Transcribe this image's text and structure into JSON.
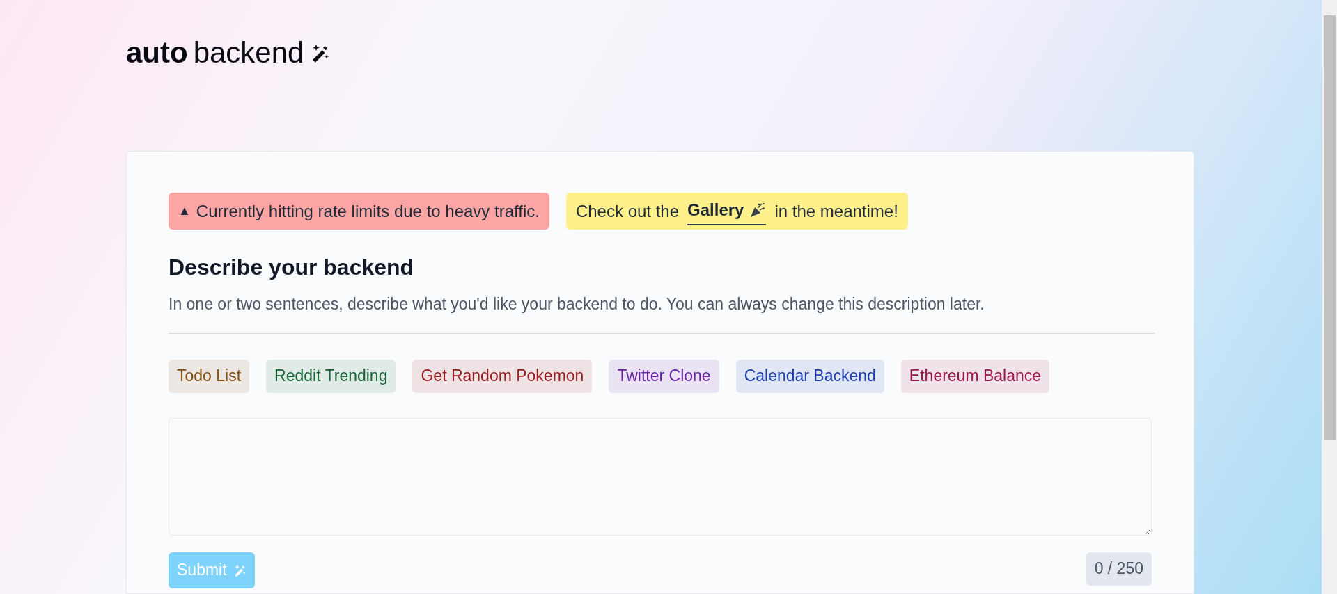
{
  "logo": {
    "bold": "auto",
    "light": "backend"
  },
  "alerts": [
    {
      "kind": "warning",
      "icon": "▲",
      "text": "Currently hitting rate limits due to heavy traffic."
    },
    {
      "kind": "info",
      "before": "Check out the",
      "link": "Gallery",
      "after": "in the meantime!"
    }
  ],
  "heading": "Describe your backend",
  "description": "In one or two sentences, describe what you'd like your backend to do. You can always change this description later.",
  "examples": [
    {
      "label": "Todo List",
      "color": "#854d0e"
    },
    {
      "label": "Reddit Trending",
      "color": "#166534"
    },
    {
      "label": "Get Random Pokemon",
      "color": "#991b1b"
    },
    {
      "label": "Twitter Clone",
      "color": "#6b21a8"
    },
    {
      "label": "Calendar Backend",
      "color": "#1e40af"
    },
    {
      "label": "Ethereum Balance",
      "color": "#9d174d"
    }
  ],
  "submit": {
    "label": "Submit",
    "disabled": true
  },
  "counter": "0 / 250"
}
